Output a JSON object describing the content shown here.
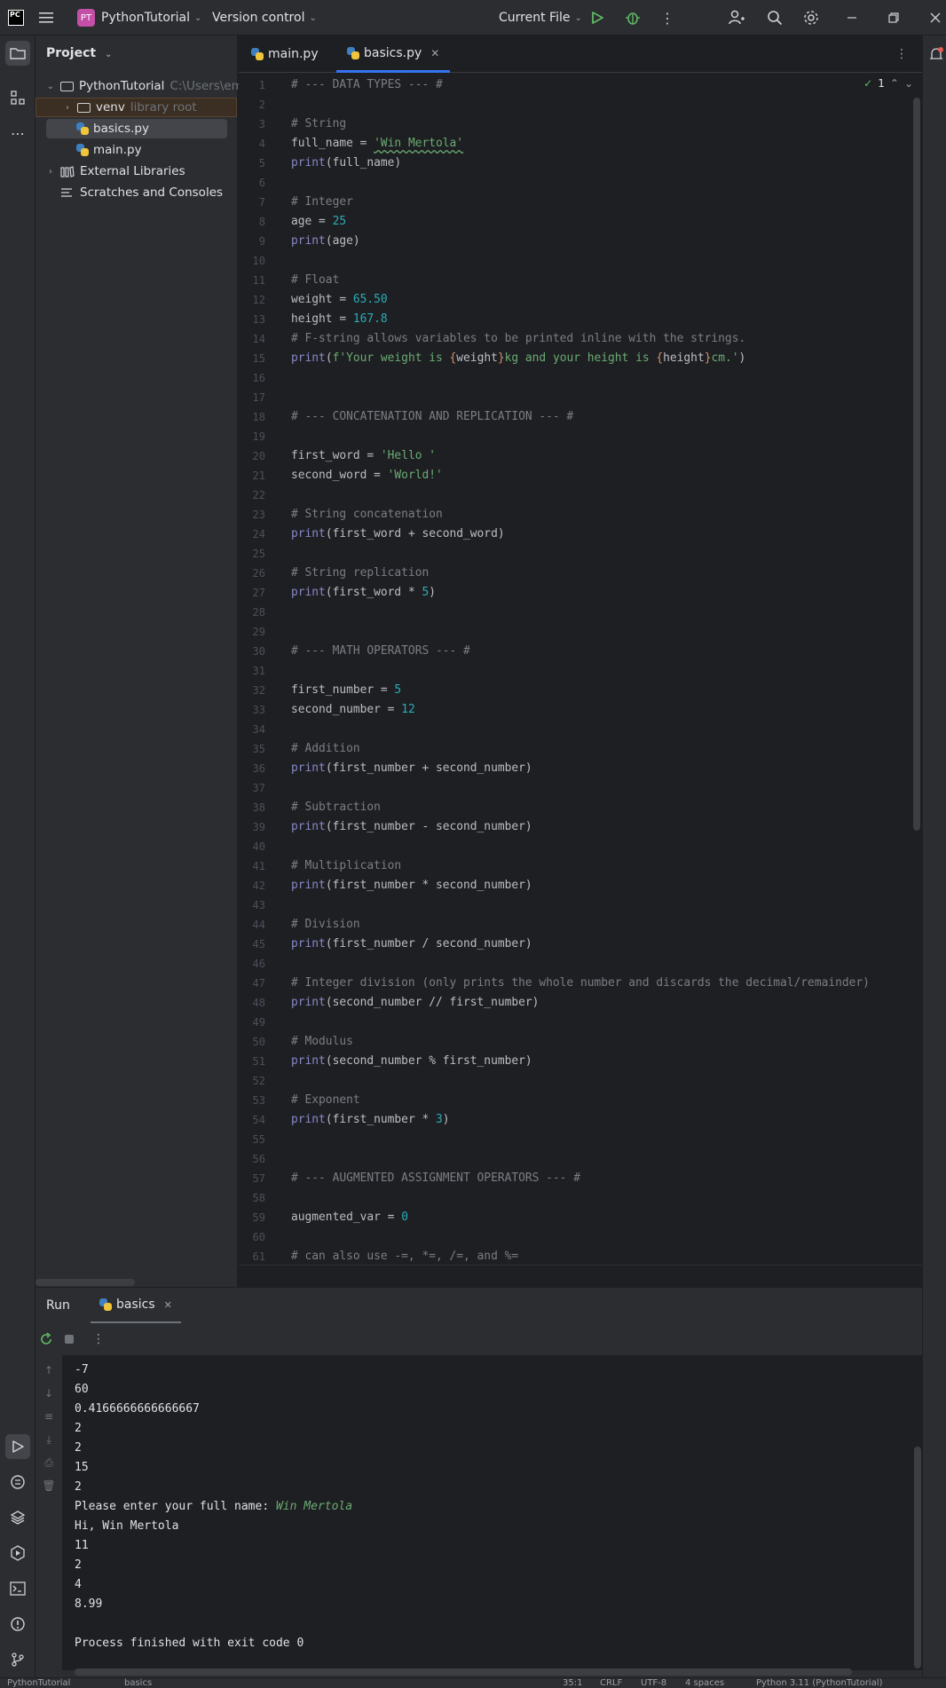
{
  "titlebar": {
    "project_badge": "PT",
    "project_name": "PythonTutorial",
    "vcs": "Version control",
    "run_config": "Current File"
  },
  "project_panel": {
    "title": "Project",
    "root_name": "PythonTutorial",
    "root_path": "C:\\Users\\em",
    "venv": "venv",
    "venv_hint": "library root",
    "file1": "basics.py",
    "file2": "main.py",
    "ext_libs": "External Libraries",
    "scratches": "Scratches and Consoles"
  },
  "tabs": [
    {
      "label": "main.py"
    },
    {
      "label": "basics.py"
    }
  ],
  "inspection_count": "1",
  "run_panel": {
    "title": "Run",
    "tab": "basics"
  },
  "status": {
    "left": "PythonTutorial",
    "file": "basics",
    "pos": "35:1",
    "eol": "CRLF",
    "enc": "UTF-8",
    "indent": "4 spaces",
    "interp": "Python 3.11 (PythonTutorial)"
  },
  "colors": {
    "accent": "#3574f0",
    "keyword_fn": "#8888c6",
    "string": "#6aab73",
    "number": "#2aacb8",
    "comment": "#7a7e85"
  },
  "code": [
    [
      [
        "c",
        "# --- DATA TYPES --- #"
      ]
    ],
    [],
    [
      [
        "c",
        "# String"
      ]
    ],
    [
      [
        "p",
        "full_name = "
      ],
      [
        "s",
        "'Win Mertola'"
      ]
    ],
    [
      [
        "f",
        "print"
      ],
      [
        "p",
        "(full_name)"
      ]
    ],
    [],
    [
      [
        "c",
        "# Integer"
      ]
    ],
    [
      [
        "p",
        "age = "
      ],
      [
        "n",
        "25"
      ]
    ],
    [
      [
        "f",
        "print"
      ],
      [
        "p",
        "(age)"
      ]
    ],
    [],
    [
      [
        "c",
        "# Float"
      ]
    ],
    [
      [
        "p",
        "weight = "
      ],
      [
        "n",
        "65.50"
      ]
    ],
    [
      [
        "p",
        "height = "
      ],
      [
        "n",
        "167.8"
      ]
    ],
    [
      [
        "c",
        "# F-string allows variables to be printed inline with the strings."
      ]
    ],
    [
      [
        "f",
        "print"
      ],
      [
        "p",
        "("
      ],
      [
        "s",
        "f'Your weight is "
      ],
      [
        "b",
        "{"
      ],
      [
        "p",
        "weight"
      ],
      [
        "b",
        "}"
      ],
      [
        "s",
        "kg and your height is "
      ],
      [
        "b",
        "{"
      ],
      [
        "p",
        "height"
      ],
      [
        "b",
        "}"
      ],
      [
        "s",
        "cm.'"
      ],
      [
        "p",
        ")"
      ]
    ],
    [],
    [],
    [
      [
        "c",
        "# --- CONCATENATION AND REPLICATION --- #"
      ]
    ],
    [],
    [
      [
        "p",
        "first_word = "
      ],
      [
        "s",
        "'Hello '"
      ]
    ],
    [
      [
        "p",
        "second_word = "
      ],
      [
        "s",
        "'World!'"
      ]
    ],
    [],
    [
      [
        "c",
        "# String concatenation"
      ]
    ],
    [
      [
        "f",
        "print"
      ],
      [
        "p",
        "(first_word + second_word)"
      ]
    ],
    [],
    [
      [
        "c",
        "# String replication"
      ]
    ],
    [
      [
        "f",
        "print"
      ],
      [
        "p",
        "(first_word * "
      ],
      [
        "n",
        "5"
      ],
      [
        "p",
        ")"
      ]
    ],
    [],
    [],
    [
      [
        "c",
        "# --- MATH OPERATORS --- #"
      ]
    ],
    [],
    [
      [
        "p",
        "first_number = "
      ],
      [
        "n",
        "5"
      ]
    ],
    [
      [
        "p",
        "second_number = "
      ],
      [
        "n",
        "12"
      ]
    ],
    [],
    [
      [
        "c",
        "# Addition"
      ]
    ],
    [
      [
        "f",
        "print"
      ],
      [
        "p",
        "(first_number + second_number)"
      ]
    ],
    [],
    [
      [
        "c",
        "# Subtraction"
      ]
    ],
    [
      [
        "f",
        "print"
      ],
      [
        "p",
        "(first_number - second_number)"
      ]
    ],
    [],
    [
      [
        "c",
        "# Multiplication"
      ]
    ],
    [
      [
        "f",
        "print"
      ],
      [
        "p",
        "(first_number * second_number)"
      ]
    ],
    [],
    [
      [
        "c",
        "# Division"
      ]
    ],
    [
      [
        "f",
        "print"
      ],
      [
        "p",
        "(first_number / second_number)"
      ]
    ],
    [],
    [
      [
        "c",
        "# Integer division (only prints the whole number and discards the decimal/remainder)"
      ]
    ],
    [
      [
        "f",
        "print"
      ],
      [
        "p",
        "(second_number // first_number)"
      ]
    ],
    [],
    [
      [
        "c",
        "# Modulus"
      ]
    ],
    [
      [
        "f",
        "print"
      ],
      [
        "p",
        "(second_number % first_number)"
      ]
    ],
    [],
    [
      [
        "c",
        "# Exponent"
      ]
    ],
    [
      [
        "f",
        "print"
      ],
      [
        "p",
        "(first_number * "
      ],
      [
        "n",
        "3"
      ],
      [
        "p",
        ")"
      ]
    ],
    [],
    [],
    [
      [
        "c",
        "# --- AUGMENTED ASSIGNMENT OPERATORS --- #"
      ]
    ],
    [],
    [
      [
        "p",
        "augmented_var = "
      ],
      [
        "n",
        "0"
      ]
    ],
    [],
    [
      [
        "c",
        "# can also use -=, *=, /=, and %="
      ]
    ]
  ],
  "console": [
    [
      [
        "t",
        "-7"
      ]
    ],
    [
      [
        "t",
        "60"
      ]
    ],
    [
      [
        "t",
        "0.4166666666666667"
      ]
    ],
    [
      [
        "t",
        "2"
      ]
    ],
    [
      [
        "t",
        "2"
      ]
    ],
    [
      [
        "t",
        "15"
      ]
    ],
    [
      [
        "t",
        "2"
      ]
    ],
    [
      [
        "t",
        "Please enter your full name: "
      ],
      [
        "i",
        "Win Mertola"
      ]
    ],
    [
      [
        "t",
        "Hi, Win Mertola"
      ]
    ],
    [
      [
        "t",
        "11"
      ]
    ],
    [
      [
        "t",
        "2"
      ]
    ],
    [
      [
        "t",
        "4"
      ]
    ],
    [
      [
        "t",
        "8.99"
      ]
    ],
    [],
    [
      [
        "t",
        "Process finished with exit code 0"
      ]
    ]
  ]
}
